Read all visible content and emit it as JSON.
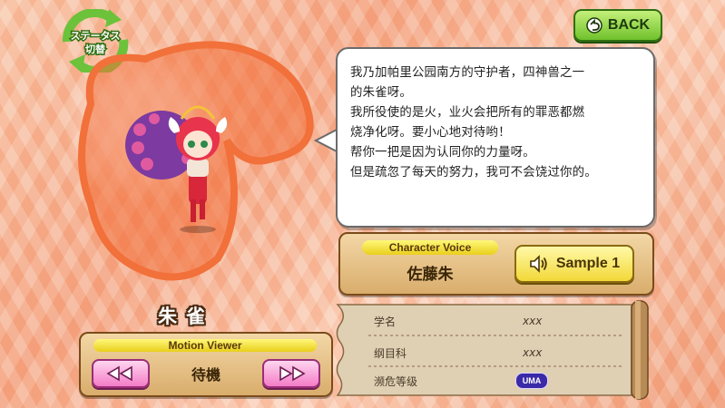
{
  "status_switch": {
    "line1": "ステータス",
    "line2": "切替"
  },
  "back_button": {
    "label": "BACK"
  },
  "dialogue": "我乃加帕里公园南方的守护者，四神兽之一\n的朱雀呀。\n我所役使的是火，业火会把所有的罪恶都燃\n烧净化呀。要小心地对待哟！\n帮你一把是因为认同你的力量呀。\n但是疏忽了每天的努力，我可不会饶过你的。",
  "voice": {
    "title": "Character Voice",
    "actor": "佐藤朱",
    "sample_label": "Sample 1"
  },
  "character": {
    "name": "朱雀"
  },
  "motion": {
    "title": "Motion Viewer",
    "current": "待機"
  },
  "info": {
    "rows": [
      {
        "label": "学名",
        "value": "xxx"
      },
      {
        "label": "纲目科",
        "value": "xxx"
      },
      {
        "label": "濒危等级",
        "value": "UMA"
      }
    ]
  },
  "colors": {
    "accent_orange": "#f2703a",
    "back_green": "#6fc12c",
    "rank_badge": "#3a2aa8"
  }
}
